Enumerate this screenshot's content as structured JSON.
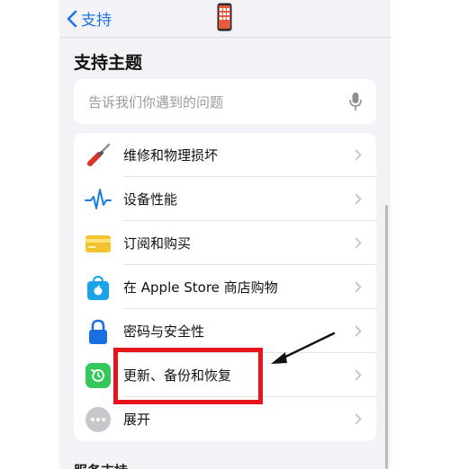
{
  "header": {
    "back_label": "支持"
  },
  "section": {
    "title": "支持主题"
  },
  "search": {
    "placeholder": "告诉我们你遇到的问题"
  },
  "topics": [
    {
      "label": "维修和物理损坏",
      "icon": "screwdriver-icon"
    },
    {
      "label": "设备性能",
      "icon": "waveform-icon"
    },
    {
      "label": "订阅和购买",
      "icon": "credit-card-icon"
    },
    {
      "label": "在 Apple Store 商店购物",
      "icon": "apple-store-bag-icon"
    },
    {
      "label": "密码与安全性",
      "icon": "lock-icon"
    },
    {
      "label": "更新、备份和恢复",
      "icon": "restore-icon"
    },
    {
      "label": "展开",
      "icon": "more-icon"
    }
  ],
  "bottom": {
    "partial_heading": "服务支持"
  },
  "colors": {
    "accent": "#1a73e8",
    "annotation": "#e8141b"
  }
}
